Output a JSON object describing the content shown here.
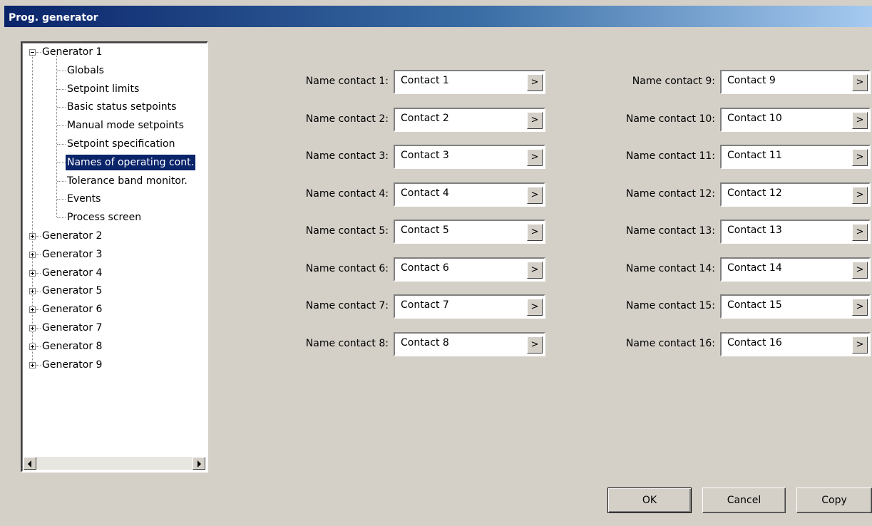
{
  "window": {
    "title": "Prog. generator"
  },
  "tree": {
    "generator1": {
      "label": "Generator 1",
      "children": [
        "Globals",
        "Setpoint limits",
        "Basic status setpoints",
        "Manual mode setpoints",
        "Setpoint specification",
        "Names of operating cont.",
        "Tolerance band monitor.",
        "Events",
        "Process screen"
      ],
      "selected_index": 5
    },
    "collapsed": [
      "Generator 2",
      "Generator 3",
      "Generator 4",
      "Generator 5",
      "Generator 6",
      "Generator 7",
      "Generator 8",
      "Generator 9"
    ]
  },
  "contacts_left": [
    {
      "label": "Name contact 1:",
      "value": "Contact 1"
    },
    {
      "label": "Name contact 2:",
      "value": "Contact 2"
    },
    {
      "label": "Name contact 3:",
      "value": "Contact 3"
    },
    {
      "label": "Name contact 4:",
      "value": "Contact 4"
    },
    {
      "label": "Name contact 5:",
      "value": "Contact 5"
    },
    {
      "label": "Name contact 6:",
      "value": "Contact 6"
    },
    {
      "label": "Name contact 7:",
      "value": "Contact 7"
    },
    {
      "label": "Name contact 8:",
      "value": "Contact 8"
    }
  ],
  "contacts_right": [
    {
      "label": "Name contact 9:",
      "value": "Contact 9"
    },
    {
      "label": "Name contact 10:",
      "value": "Contact 10"
    },
    {
      "label": "Name contact 11:",
      "value": "Contact 11"
    },
    {
      "label": "Name contact 12:",
      "value": "Contact 12"
    },
    {
      "label": "Name contact 13:",
      "value": "Contact 13"
    },
    {
      "label": "Name contact 14:",
      "value": "Contact 14"
    },
    {
      "label": "Name contact 15:",
      "value": "Contact 15"
    },
    {
      "label": "Name contact 16:",
      "value": "Contact 16"
    }
  ],
  "field_button_glyph": ">",
  "buttons": {
    "ok": "OK",
    "cancel": "Cancel",
    "copy": "Copy"
  },
  "colors": {
    "selection": "#0a246a",
    "title_gradient_start": "#0a246a",
    "title_gradient_end": "#a6caf0",
    "window_bg": "#d4d0c8"
  }
}
